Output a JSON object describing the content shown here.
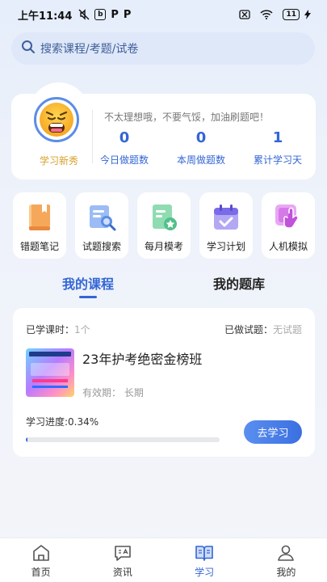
{
  "status_bar": {
    "time": "上午11:44",
    "battery": "11"
  },
  "search": {
    "placeholder": "搜索课程/考题/试卷"
  },
  "profile": {
    "level": "学习新秀",
    "motto": "不太理想哦，不要气馁，加油刷题吧！",
    "stats": [
      {
        "value": "0",
        "label": "今日做题数"
      },
      {
        "value": "0",
        "label": "本周做题数"
      },
      {
        "value": "1",
        "label": "累计学习天"
      }
    ]
  },
  "actions": [
    {
      "label": "错题笔记",
      "icon": "wrong-notes-icon",
      "color": "#f5a85a"
    },
    {
      "label": "试题搜索",
      "icon": "question-search-icon",
      "color": "#5b8de6"
    },
    {
      "label": "每月模考",
      "icon": "monthly-exam-icon",
      "color": "#52c08a"
    },
    {
      "label": "学习计划",
      "icon": "study-plan-icon",
      "color": "#7a6ce8"
    },
    {
      "label": "人机模拟",
      "icon": "simulation-icon",
      "color": "#d679e8"
    }
  ],
  "tabs": [
    {
      "label": "我的课程",
      "active": true
    },
    {
      "label": "我的题库",
      "active": false
    }
  ],
  "course": {
    "studied_label": "已学课时：",
    "studied_value": "1个",
    "tests_label": "已做试题：",
    "tests_value": "无试题",
    "title": "23年护考绝密金榜班",
    "validity": "有效期：  长期",
    "progress_label": "学习进度:0.34%",
    "progress_percent": 0.34,
    "button": "去学习"
  },
  "bottom_nav": [
    {
      "label": "首页",
      "icon": "home-icon",
      "active": false
    },
    {
      "label": "资讯",
      "icon": "news-icon",
      "active": false
    },
    {
      "label": "学习",
      "icon": "study-icon",
      "active": true
    },
    {
      "label": "我的",
      "icon": "profile-icon",
      "active": false
    }
  ],
  "colors": {
    "accent": "#3466d4",
    "level": "#d9a12b"
  }
}
